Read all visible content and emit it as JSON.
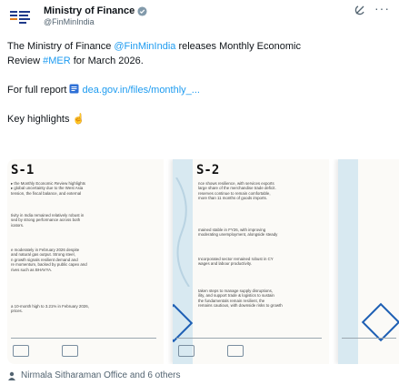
{
  "post": {
    "display_name": "Ministry of Finance",
    "handle": "@FinMinIndia",
    "text_intro": "The Ministry of Finance ",
    "text_mention": "@FinMinIndia",
    "text_mid": " releases Monthly Economic",
    "text_line2_a": "Review ",
    "text_hashtag": "#MER",
    "text_line2_b": " for March 2026.",
    "full_report_label": "For full report ",
    "report_link": "dea.gov.in/files/monthly_...",
    "key_highlights": "Key highlights ☝"
  },
  "slides": [
    {
      "number": "S-1",
      "paras": [
        "▸ the Monthly Economic Review highlights\n▸ global uncertainty due to the West Asia\ntension, the fiscal balance, and external",
        "tivity in India remained relatively robust in\nsed by strong performance across both\nicators.",
        "e moderately in February 2026 despite\nand natural gas output. Strong steel,\nn growth signals resilient demand and\nre momentum, backed by public capex and\nrives such as BHAVYA.",
        "a 10-month high to 3.21% in February 2026,\nprices."
      ]
    },
    {
      "number": "S-2",
      "paras": [
        "nce shows resilience, with services exports\nlarge share of the merchandise trade deficit.\nreserves continue to remain comfortable,\nmore than 11 months of goods imports.",
        "mained stable in FY26, with improving\nmoderating unemployment, alongside steady",
        "Incorporated sector remained robust in CY\nwages and labour productivity.",
        "taken steps to manage supply disruptions,\nility, and support trade & logistics to sustain\nthe fundamentals remain resilient, the\nremains cautious, with downside risks to growth"
      ]
    }
  ],
  "tagged": "Nirmala Sitharaman Office and 6 others"
}
